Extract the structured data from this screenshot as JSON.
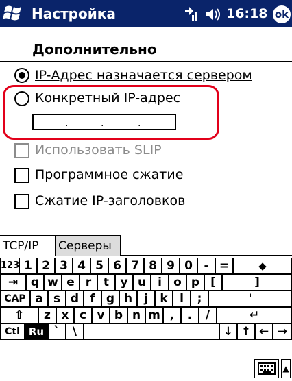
{
  "status_bar": {
    "title": "Настройка",
    "time": "16:18",
    "ok_label": "ok"
  },
  "page": {
    "section_title": "Дополнительно"
  },
  "options": {
    "server_ip": {
      "label": "IP-Адрес назначается сервером",
      "selected": true
    },
    "specific_ip": {
      "label": "Конкретный IP-адрес",
      "selected": false
    },
    "ip_dots": [
      ".",
      ".",
      "."
    ],
    "use_slip": {
      "label": "Использовать SLIP",
      "checked": false,
      "enabled": false
    },
    "software_compression": {
      "label": "Программное сжатие",
      "checked": false
    },
    "ip_header_compression": {
      "label": "Сжатие IP-заголовков",
      "checked": false
    }
  },
  "tabs": [
    {
      "label": "TCP/IP",
      "active": true
    },
    {
      "label": "Серверы",
      "active": false
    }
  ],
  "keyboard": {
    "rows": [
      [
        "123",
        "1",
        "2",
        "3",
        "4",
        "5",
        "6",
        "7",
        "8",
        "9",
        "0",
        "-",
        "=",
        "◆"
      ],
      [
        "⇥",
        "q",
        "w",
        "e",
        "r",
        "t",
        "y",
        "u",
        "i",
        "o",
        "p",
        "[",
        "]"
      ],
      [
        "CAP",
        "a",
        "s",
        "d",
        "f",
        "g",
        "h",
        "j",
        "k",
        "l",
        ";",
        "'"
      ],
      [
        "⇧",
        "z",
        "x",
        "c",
        "v",
        "b",
        "n",
        "m",
        ",",
        ".",
        "/",
        "↵"
      ],
      [
        "Ctl",
        "Ru",
        "`",
        "\\",
        "",
        "↓",
        "↑",
        "←",
        "→"
      ]
    ]
  },
  "colors": {
    "title_bar": "#0a246a",
    "highlight": "#e2001a"
  }
}
